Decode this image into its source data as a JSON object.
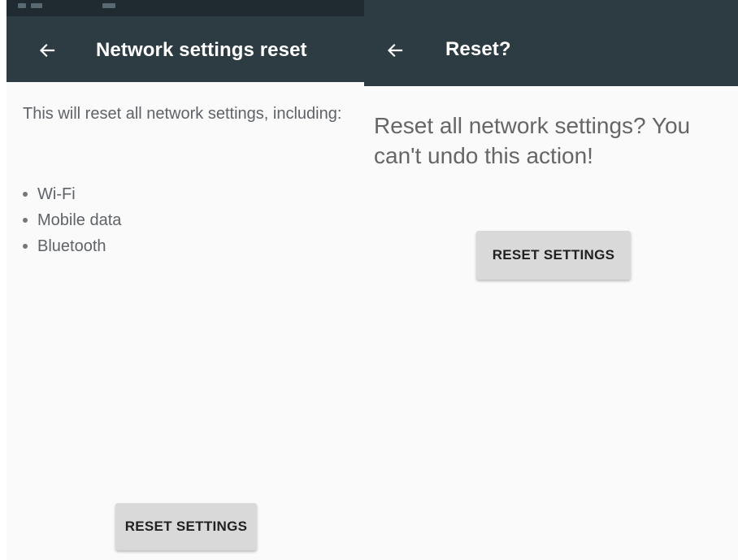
{
  "left_screen": {
    "title": "Network settings reset",
    "back_icon": "arrow-left-icon",
    "description": "This will reset all network settings, including:",
    "items": [
      {
        "label": "Wi-Fi"
      },
      {
        "label": "Mobile data"
      },
      {
        "label": "Bluetooth"
      }
    ],
    "button_label": "RESET SETTINGS"
  },
  "right_screen": {
    "title": "Reset?",
    "back_icon": "arrow-left-icon",
    "description": "Reset all network settings? You can't undo this action!",
    "button_label": "RESET SETTINGS"
  },
  "colors": {
    "app_bar": "#2d3b42",
    "status_bar": "#1f2b31",
    "background": "#fafafa",
    "button": "#d9d9d9",
    "body_text": "#5f6368"
  }
}
